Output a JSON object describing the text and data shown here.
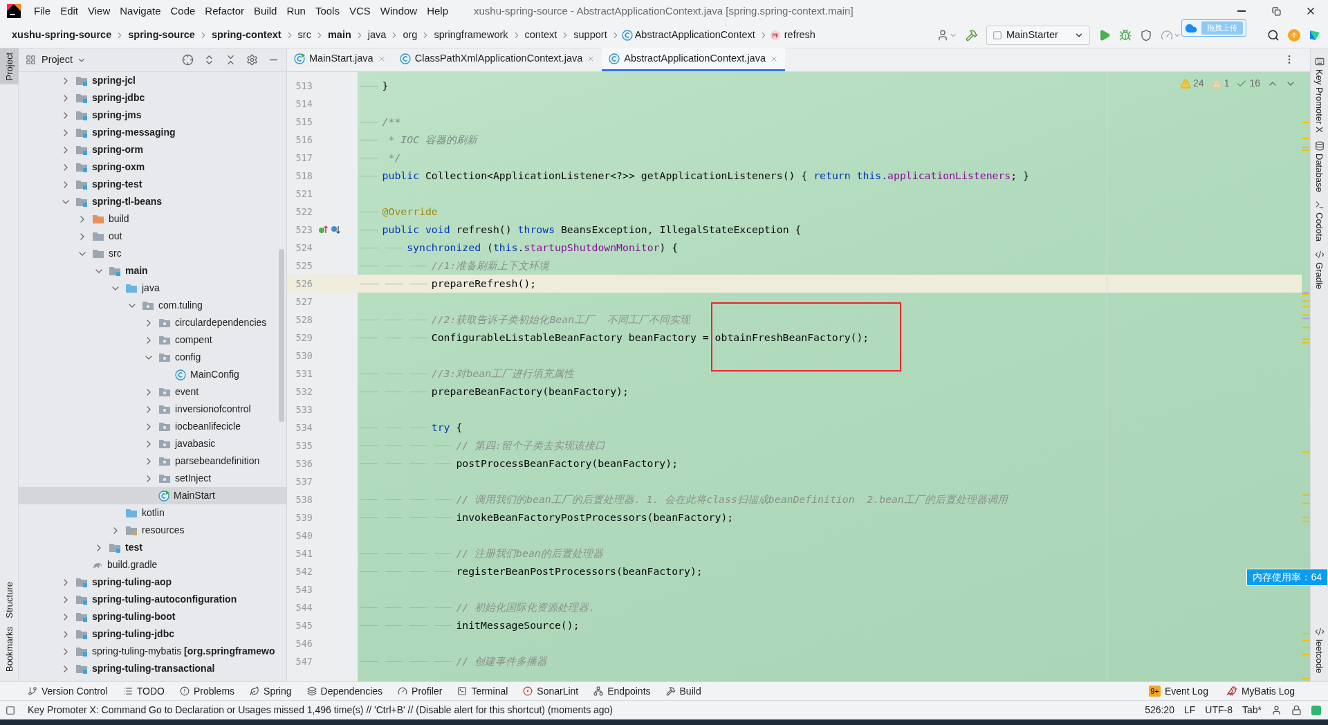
{
  "window": {
    "title": "xushu-spring-source - AbstractApplicationContext.java [spring.spring-context.main]"
  },
  "menu": [
    "File",
    "Edit",
    "View",
    "Navigate",
    "Code",
    "Refactor",
    "Build",
    "Run",
    "Tools",
    "VCS",
    "Window",
    "Help"
  ],
  "breadcrumbs": [
    {
      "label": "xushu-spring-source",
      "kind": "bold"
    },
    {
      "label": "spring-source",
      "kind": "bold"
    },
    {
      "label": "spring-context",
      "kind": "bold"
    },
    {
      "label": "src",
      "kind": "plain"
    },
    {
      "label": "main",
      "kind": "bold"
    },
    {
      "label": "java",
      "kind": "plain"
    },
    {
      "label": "org",
      "kind": "plain"
    },
    {
      "label": "springframework",
      "kind": "plain"
    },
    {
      "label": "context",
      "kind": "plain"
    },
    {
      "label": "support",
      "kind": "plain"
    },
    {
      "label": "AbstractApplicationContext",
      "kind": "class"
    },
    {
      "label": "refresh",
      "kind": "method"
    }
  ],
  "run_configuration": "MainStarter",
  "upload_widget": {
    "button": "拖拽上传"
  },
  "left_toolbar": [
    {
      "label": "Project",
      "selected": true
    },
    {
      "label": "Structure",
      "selected": false
    },
    {
      "label": "Bookmarks",
      "selected": false
    }
  ],
  "right_toolbar": [
    {
      "label": "Key Promoter X",
      "kind": "key"
    },
    {
      "label": "Database",
      "kind": "database"
    },
    {
      "label": "Codota",
      "kind": "codota"
    },
    {
      "label": "Gradle",
      "kind": "gradle"
    },
    {
      "label": "leetcode",
      "kind": "leetcode"
    }
  ],
  "project": {
    "title": "Project",
    "tree": [
      {
        "label": "spring-jcl",
        "kind": "module",
        "expanded": false,
        "selected": false
      },
      {
        "label": "spring-jdbc",
        "kind": "module",
        "expanded": false,
        "selected": false
      },
      {
        "label": "spring-jms",
        "kind": "module",
        "expanded": false,
        "selected": false
      },
      {
        "label": "spring-messaging",
        "kind": "module",
        "expanded": false,
        "selected": false
      },
      {
        "label": "spring-orm",
        "kind": "module",
        "expanded": false,
        "selected": false
      },
      {
        "label": "spring-oxm",
        "kind": "module",
        "expanded": false,
        "selected": false
      },
      {
        "label": "spring-test",
        "kind": "module",
        "expanded": false,
        "selected": false
      },
      {
        "label": "spring-tl-beans",
        "kind": "module",
        "expanded": true,
        "selected": false,
        "children": [
          {
            "label": "build",
            "kind": "excluded",
            "expanded": false,
            "selected": false
          },
          {
            "label": "out",
            "kind": "folder",
            "expanded": false,
            "selected": false
          },
          {
            "label": "src",
            "kind": "folder",
            "expanded": true,
            "selected": false,
            "children": [
              {
                "label": "main",
                "kind": "source_root",
                "expanded": true,
                "selected": false,
                "children": [
                  {
                    "label": "java",
                    "kind": "java_root",
                    "expanded": true,
                    "selected": false,
                    "children": [
                      {
                        "label": "com.tuling",
                        "kind": "package",
                        "expanded": true,
                        "selected": false,
                        "children": [
                          {
                            "label": "circulardependencies",
                            "kind": "package",
                            "expanded": false,
                            "selected": false
                          },
                          {
                            "label": "compent",
                            "kind": "package",
                            "expanded": false,
                            "selected": false
                          },
                          {
                            "label": "config",
                            "kind": "package",
                            "expanded": true,
                            "selected": false,
                            "children": [
                              {
                                "label": "MainConfig",
                                "kind": "class",
                                "selected": false
                              }
                            ]
                          },
                          {
                            "label": "event",
                            "kind": "package",
                            "expanded": false,
                            "selected": false
                          },
                          {
                            "label": "inversionofcontrol",
                            "kind": "package",
                            "expanded": false,
                            "selected": false
                          },
                          {
                            "label": "iocbeanlifecicle",
                            "kind": "package",
                            "expanded": false,
                            "selected": false
                          },
                          {
                            "label": "javabasic",
                            "kind": "package",
                            "expanded": false,
                            "selected": false
                          },
                          {
                            "label": "parsebeandefinition",
                            "kind": "package",
                            "expanded": false,
                            "selected": false
                          },
                          {
                            "label": "setInject",
                            "kind": "package",
                            "expanded": false,
                            "selected": false
                          },
                          {
                            "label": "MainStart",
                            "kind": "run_class",
                            "selected": true
                          }
                        ]
                      }
                    ]
                  },
                  {
                    "label": "kotlin",
                    "kind": "java_root",
                    "selected": false
                  },
                  {
                    "label": "resources",
                    "kind": "resources",
                    "expanded": false,
                    "selected": false
                  }
                ]
              },
              {
                "label": "test",
                "kind": "source_root",
                "expanded": false,
                "selected": false
              }
            ]
          },
          {
            "label": "build.gradle",
            "kind": "gradle",
            "selected": false
          }
        ]
      },
      {
        "label": "spring-tuling-aop",
        "kind": "module",
        "expanded": false,
        "selected": false
      },
      {
        "label": "spring-tuling-autoconfiguration",
        "kind": "module",
        "expanded": false,
        "selected": false
      },
      {
        "label": "spring-tuling-boot",
        "kind": "module",
        "expanded": false,
        "selected": false
      },
      {
        "label": "spring-tuling-jdbc",
        "kind": "module",
        "expanded": false,
        "selected": false
      },
      {
        "label": "spring-tuling-mybatis **[org.springframewo**",
        "kind": "module_plain",
        "expanded": false,
        "selected": false
      },
      {
        "label": "spring-tuling-transactional",
        "kind": "module",
        "expanded": false,
        "selected": false
      }
    ]
  },
  "editor": {
    "tabs": [
      {
        "label": "MainStart.java",
        "kind": "run_class",
        "selected": false
      },
      {
        "label": "ClassPathXmlApplicationContext.java",
        "kind": "class",
        "selected": false
      },
      {
        "label": "AbstractApplicationContext.java",
        "kind": "class",
        "selected": true
      }
    ],
    "inspections": {
      "warnings": "24",
      "weak_warnings": "1",
      "typos": "16"
    },
    "lines": [
      {
        "number": "513",
        "current": false,
        "marker": false,
        "code": [
          {
            "kind": "plain",
            "text": "\t}"
          }
        ]
      },
      {
        "number": "514",
        "current": false,
        "marker": false
      },
      {
        "number": "515",
        "current": false,
        "marker": false,
        "code": [
          {
            "kind": "doc",
            "text": "\t/**"
          }
        ]
      },
      {
        "number": "516",
        "current": false,
        "marker": false,
        "code": [
          {
            "kind": "doc",
            "text": "\t * IOC 容器的刷新"
          }
        ]
      },
      {
        "number": "517",
        "current": false,
        "marker": false,
        "code": [
          {
            "kind": "doc",
            "text": "\t */"
          }
        ]
      },
      {
        "number": "518",
        "current": false,
        "marker": false,
        "code": [
          {
            "kind": "keyword",
            "text": "\tpublic"
          },
          {
            "kind": "plain",
            "text": " Collection<ApplicationListener<?>> getApplicationListeners() { "
          },
          {
            "kind": "keyword",
            "text": "return this."
          },
          {
            "kind": "field",
            "text": "applicationListeners"
          },
          {
            "kind": "plain",
            "text": "; }"
          }
        ]
      },
      {
        "number": "521",
        "current": false,
        "marker": false
      },
      {
        "number": "522",
        "current": false,
        "marker": false,
        "code": [
          {
            "kind": "annotation",
            "text": "\t@Override"
          }
        ]
      },
      {
        "number": "523",
        "current": false,
        "marker": true,
        "code": [
          {
            "kind": "keyword",
            "text": "\tpublic void"
          },
          {
            "kind": "plain",
            "text": " refresh() "
          },
          {
            "kind": "keyword",
            "text": "throws"
          },
          {
            "kind": "plain",
            "text": " BeansException, IllegalStateException {"
          }
        ]
      },
      {
        "number": "524",
        "current": false,
        "marker": false,
        "code": [
          {
            "kind": "keyword",
            "text": "\t\tsynchronized"
          },
          {
            "kind": "plain",
            "text": " ("
          },
          {
            "kind": "keyword",
            "text": "this"
          },
          {
            "kind": "plain",
            "text": "."
          },
          {
            "kind": "field",
            "text": "startupShutdownMonitor"
          },
          {
            "kind": "plain",
            "text": ") {"
          }
        ]
      },
      {
        "number": "525",
        "current": false,
        "marker": false,
        "code": [
          {
            "kind": "comment",
            "text": "\t\t\t//1:准备刷新上下文环境"
          }
        ]
      },
      {
        "number": "526",
        "current": true,
        "marker": false,
        "code": [
          {
            "kind": "plain",
            "text": "\t\t\tprepareRefresh();"
          }
        ]
      },
      {
        "number": "527",
        "current": false,
        "marker": false
      },
      {
        "number": "528",
        "current": false,
        "marker": false,
        "code": [
          {
            "kind": "comment",
            "text": "\t\t\t//2:获取告诉子类初始化Bean工厂  不同工厂不同实现"
          }
        ]
      },
      {
        "number": "529",
        "current": false,
        "marker": false,
        "code": [
          {
            "kind": "plain",
            "text": "\t\t\tConfigurableListableBeanFactory beanFactory = obtainFreshBeanFactory();"
          }
        ]
      },
      {
        "number": "530",
        "current": false,
        "marker": false
      },
      {
        "number": "531",
        "current": false,
        "marker": false,
        "code": [
          {
            "kind": "comment",
            "text": "\t\t\t//3:对bean工厂进行填充属性"
          }
        ]
      },
      {
        "number": "532",
        "current": false,
        "marker": false,
        "code": [
          {
            "kind": "plain",
            "text": "\t\t\tprepareBeanFactory(beanFactory);"
          }
        ]
      },
      {
        "number": "533",
        "current": false,
        "marker": false
      },
      {
        "number": "534",
        "current": false,
        "marker": false,
        "code": [
          {
            "kind": "keyword",
            "text": "\t\t\ttry"
          },
          {
            "kind": "plain",
            "text": " {"
          }
        ]
      },
      {
        "number": "535",
        "current": false,
        "marker": false,
        "code": [
          {
            "kind": "comment",
            "text": "\t\t\t\t// 第四:留个子类去实现该接口"
          }
        ]
      },
      {
        "number": "536",
        "current": false,
        "marker": false,
        "code": [
          {
            "kind": "plain",
            "text": "\t\t\t\tpostProcessBeanFactory(beanFactory);"
          }
        ]
      },
      {
        "number": "537",
        "current": false,
        "marker": false
      },
      {
        "number": "538",
        "current": false,
        "marker": false,
        "code": [
          {
            "kind": "comment",
            "text": "\t\t\t\t// 调用我们的bean工厂的后置处理器. 1. 会在此将class扫描成beanDefinition  2.bean工厂的后置处理器调用"
          }
        ]
      },
      {
        "number": "539",
        "current": false,
        "marker": false,
        "code": [
          {
            "kind": "plain",
            "text": "\t\t\t\tinvokeBeanFactoryPostProcessors(beanFactory);"
          }
        ]
      },
      {
        "number": "540",
        "current": false,
        "marker": false
      },
      {
        "number": "541",
        "current": false,
        "marker": false,
        "code": [
          {
            "kind": "comment",
            "text": "\t\t\t\t// 注册我们bean的后置处理器"
          }
        ]
      },
      {
        "number": "542",
        "current": false,
        "marker": false,
        "code": [
          {
            "kind": "plain",
            "text": "\t\t\t\tregisterBeanPostProcessors(beanFactory);"
          }
        ]
      },
      {
        "number": "543",
        "current": false,
        "marker": false
      },
      {
        "number": "544",
        "current": false,
        "marker": false,
        "code": [
          {
            "kind": "comment",
            "text": "\t\t\t\t// 初始化国际化资源处理器."
          }
        ]
      },
      {
        "number": "545",
        "current": false,
        "marker": false,
        "code": [
          {
            "kind": "plain",
            "text": "\t\t\t\tinitMessageSource();"
          }
        ]
      },
      {
        "number": "546",
        "current": false,
        "marker": false
      },
      {
        "number": "547",
        "current": false,
        "marker": false,
        "code": [
          {
            "kind": "comment",
            "text": "\t\t\t\t// 创建事件多播器"
          }
        ]
      }
    ]
  },
  "memory_badge": "内存使用率：64",
  "tool_windows": [
    {
      "label": "Version Control",
      "kind": "vcs"
    },
    {
      "label": "TODO",
      "kind": "todo"
    },
    {
      "label": "Problems",
      "kind": "problems"
    },
    {
      "label": "Spring",
      "kind": "spring"
    },
    {
      "label": "Dependencies",
      "kind": "dependencies"
    },
    {
      "label": "Profiler",
      "kind": "profiler"
    },
    {
      "label": "Terminal",
      "kind": "terminal"
    },
    {
      "label": "SonarLint",
      "kind": "sonar"
    },
    {
      "label": "Endpoints",
      "kind": "endpoints"
    },
    {
      "label": "Build",
      "kind": "build"
    }
  ],
  "tool_windows_right": [
    {
      "label": "Event Log",
      "badge": "9+"
    },
    {
      "label": "MyBatis Log"
    }
  ],
  "status_bar": {
    "message": "Key Promoter X: Command Go to Declaration or Usages missed 1,496 time(s) // 'Ctrl+B' // (Disable alert for this shortcut) (moments ago)",
    "position": "526:20",
    "line_separator": "LF",
    "encoding": "UTF-8",
    "indent": "Tab*"
  }
}
